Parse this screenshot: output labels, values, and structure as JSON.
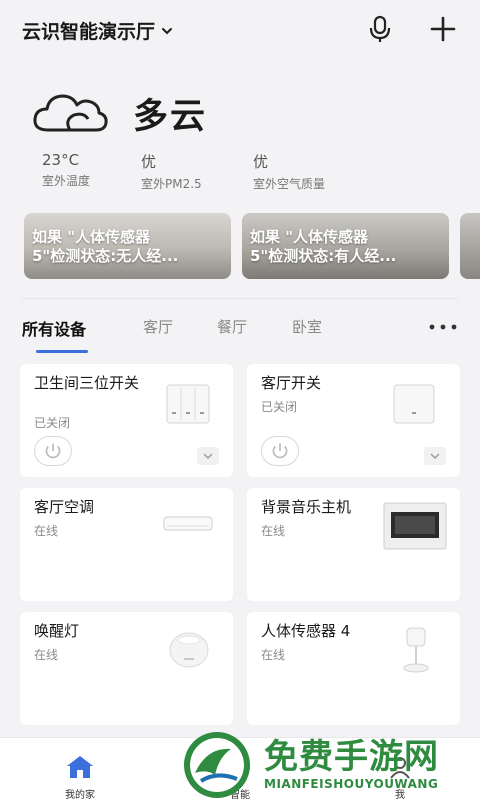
{
  "header": {
    "home_name": "云识智能演示厅",
    "icons": [
      "chevron-down-icon",
      "microphone-icon",
      "plus-icon"
    ]
  },
  "weather": {
    "condition": "多云",
    "icon": "cloud-icon",
    "stats": [
      {
        "value": "23°C",
        "label": "室外温度"
      },
      {
        "value": "优",
        "label": "室外PM2.5"
      },
      {
        "value": "优",
        "label": "室外空气质量"
      }
    ]
  },
  "scenes": [
    {
      "line1": "如果 \"人体传感器",
      "line2": "5\"检测状态:无人经..."
    },
    {
      "line1": "如果 \"人体传感器",
      "line2": "5\"检测状态:有人经..."
    }
  ],
  "tabs": [
    {
      "label": "所有设备",
      "active": true
    },
    {
      "label": "客厅",
      "active": false
    },
    {
      "label": "餐厅",
      "active": false
    },
    {
      "label": "卧室",
      "active": false
    }
  ],
  "devices": [
    {
      "name": "卫生间三位开关",
      "status": "已关闭",
      "icon": "triple-switch-icon",
      "has_power": true
    },
    {
      "name": "客厅开关",
      "status": "已关闭",
      "icon": "single-switch-icon",
      "has_power": true
    },
    {
      "name": "客厅空调",
      "status": "在线",
      "icon": "air-conditioner-icon",
      "has_power": false
    },
    {
      "name": "背景音乐主机",
      "status": "在线",
      "icon": "music-host-icon",
      "has_power": false
    },
    {
      "name": "唤醒灯",
      "status": "在线",
      "icon": "wake-light-icon",
      "has_power": false
    },
    {
      "name": "人体传感器 4",
      "status": "在线",
      "icon": "motion-sensor-icon",
      "has_power": false
    }
  ],
  "bottom_nav": [
    {
      "label": "我的家",
      "icon": "home-icon"
    },
    {
      "label": "智能",
      "icon": "smart-icon"
    },
    {
      "label": "我",
      "icon": "profile-icon"
    }
  ],
  "watermark": {
    "title": "免费手游网",
    "subtitle": "MIANFEISHOUYOUWANG"
  },
  "colors": {
    "accent": "#3a6fdc",
    "background": "#f3f3f5",
    "watermark": "#2e8b3f"
  }
}
